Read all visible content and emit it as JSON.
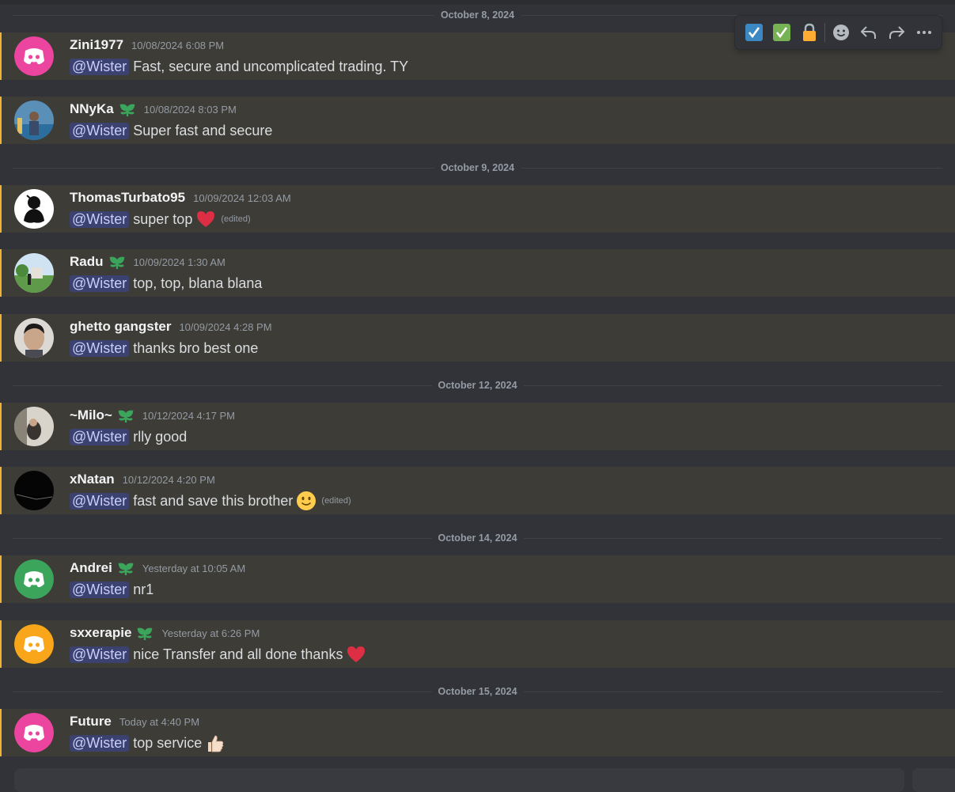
{
  "dates": [
    "October 8, 2024",
    "October 9, 2024",
    "October 12, 2024",
    "October 14, 2024",
    "October 15, 2024"
  ],
  "mention": "@Wister",
  "messages": [
    {
      "user": "Zini1977",
      "time": "10/08/2024 6:08 PM",
      "text": "Fast, secure and uncomplicated trading. TY"
    },
    {
      "user": "NNyKa",
      "time": "10/08/2024 8:03 PM",
      "text": "Super fast and secure"
    },
    {
      "user": "ThomasTurbato95",
      "time": "10/09/2024 12:03 AM",
      "text": " super top",
      "edited": "(edited)"
    },
    {
      "user": "Radu",
      "time": "10/09/2024 1:30 AM",
      "text": "top, top, blana blana"
    },
    {
      "user": "ghetto gangster",
      "time": "10/09/2024 4:28 PM",
      "text": "thanks bro best one"
    },
    {
      "user": "~Milo~",
      "time": "10/12/2024 4:17 PM",
      "text": "rlly good"
    },
    {
      "user": "xNatan",
      "time": "10/12/2024 4:20 PM",
      "text": " fast and save this brother",
      "edited": "(edited)"
    },
    {
      "user": "Andrei",
      "time": "Yesterday at 10:05 AM",
      "text": "nr1"
    },
    {
      "user": "sxxerapie",
      "time": "Yesterday at 6:26 PM",
      "text": "nice Transfer and all done thanks"
    },
    {
      "user": "Future",
      "time": "Today at 4:40 PM",
      "text": "top service"
    }
  ],
  "colors": {
    "background": "#313338",
    "highlight": "#3d3c37",
    "highlight_bar": "#f0b232",
    "mention_bg": "#3c4270",
    "mention_text": "#c9cdfb",
    "avatar_pink": "#eb459f",
    "avatar_green": "#3ba55c",
    "avatar_orange": "#faa61a",
    "badge_green": "#3ba55c"
  },
  "icons": {
    "discord_default_avatar": "discord-logo-icon",
    "nitro_badge": "leaf-badge-icon",
    "toolbar": [
      "checkbox-blue-icon",
      "check-mark-green-icon",
      "lock-icon",
      "emoji-icon",
      "reply-icon",
      "forward-icon",
      "more-icon"
    ],
    "emojis": [
      "red-heart-icon",
      "slight-smile-icon",
      "red-heart-icon",
      "thumbs-up-icon"
    ]
  }
}
